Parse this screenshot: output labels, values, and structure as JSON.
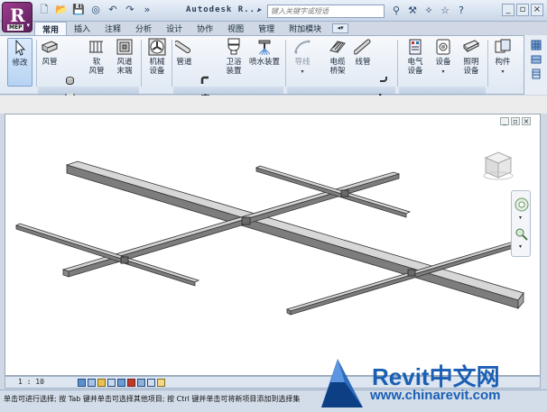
{
  "app": {
    "logo_letter": "R",
    "logo_badge": "MEP",
    "doc_title": "Autodesk R...",
    "search_placeholder": "键入关键字或短语"
  },
  "tabs": [
    {
      "label": "常用",
      "active": true
    },
    {
      "label": "插入"
    },
    {
      "label": "注释"
    },
    {
      "label": "分析"
    },
    {
      "label": "设计"
    },
    {
      "label": "协作"
    },
    {
      "label": "视图"
    },
    {
      "label": "管理"
    },
    {
      "label": "附加模块"
    }
  ],
  "ribbon": {
    "modify": "修改",
    "duct": "风管",
    "flex_duct": [
      "软",
      "风管"
    ],
    "air_terminal": [
      "风道",
      "末端"
    ],
    "mech_equipment": [
      "机械",
      "设备"
    ],
    "pipe": "管道",
    "plumbing_fixture": [
      "卫浴",
      "装置"
    ],
    "sprinkler": "喷水装置",
    "wire": "导线",
    "cable_tray": [
      "电缆",
      "桥架"
    ],
    "conduit": "线管",
    "electrical_equipment": [
      "电气",
      "设备"
    ],
    "device": "设备",
    "lighting_fixture": [
      "照明",
      "设备"
    ],
    "component": "构件"
  },
  "view": {
    "scale": "1 : 10"
  },
  "status": {
    "text": "单击可进行选择; 按 Tab 键并单击可选择其他项目; 按 Ctrl 键并单击可将新项目添加到选择集"
  },
  "watermark": {
    "brand": "Revit中文网",
    "url": "www.chinarevit.com"
  },
  "colors": {
    "ribbon_bg": "#dfe8f3",
    "accent": "#1a5fb4",
    "beam": "#8a8a8a"
  }
}
